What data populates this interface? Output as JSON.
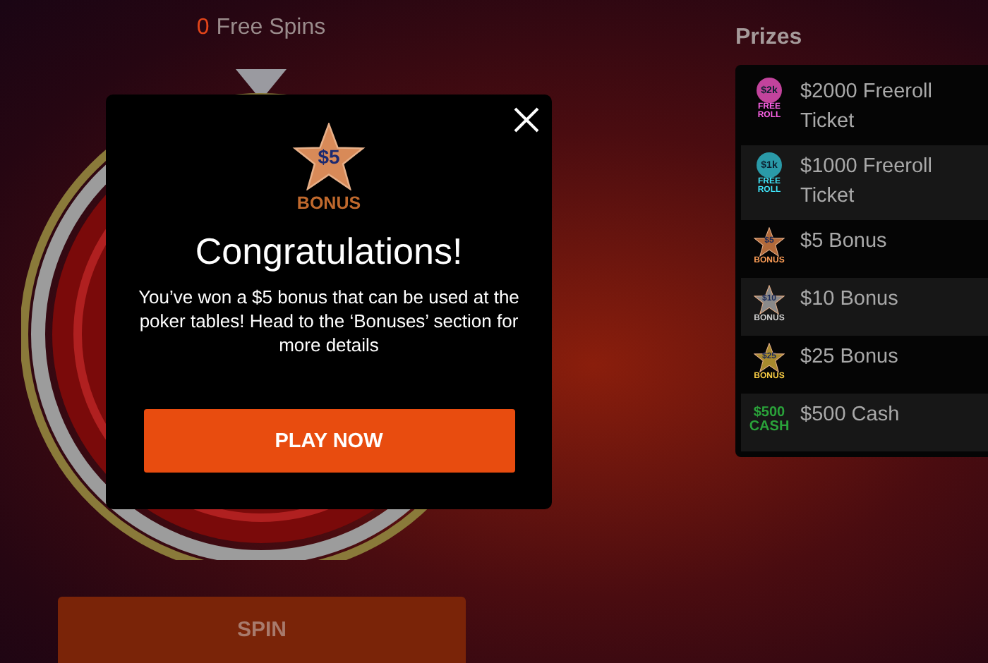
{
  "spins": {
    "count": "0",
    "label": "Free Spins"
  },
  "spin_button": {
    "label": "SPIN",
    "disabled": true
  },
  "prizes": {
    "title": "Prizes",
    "items": [
      {
        "label": "$2000 Freeroll Ticket",
        "icon": {
          "kind": "freeroll",
          "amount": "$2k",
          "caption": "FREE ROLL",
          "color": "#c2439c"
        }
      },
      {
        "label": "$1000 Freeroll Ticket",
        "icon": {
          "kind": "freeroll",
          "amount": "$1k",
          "caption": "FREE ROLL",
          "color": "#2a9aa8"
        }
      },
      {
        "label": "$5 Bonus",
        "icon": {
          "kind": "star",
          "amount": "$5",
          "caption": "BONUS",
          "color": "#b26a3a"
        }
      },
      {
        "label": "$10 Bonus",
        "icon": {
          "kind": "star",
          "amount": "$10",
          "caption": "BONUS",
          "color": "#8a8a8a"
        }
      },
      {
        "label": "$25 Bonus",
        "icon": {
          "kind": "star",
          "amount": "$25",
          "caption": "BONUS",
          "color": "#a88a2e"
        }
      },
      {
        "label": "$500 Cash",
        "icon": {
          "kind": "cash",
          "amount": "$500",
          "caption": "CASH",
          "color": "#2aa23a"
        }
      }
    ]
  },
  "modal": {
    "badge": {
      "amount": "$5",
      "caption": "BONUS"
    },
    "title": "Congratulations!",
    "message": "You’ve won a $5 bonus that can be used at the poker tables! Head to the ‘Bonuses’ section for more details",
    "button": "PLAY NOW"
  }
}
